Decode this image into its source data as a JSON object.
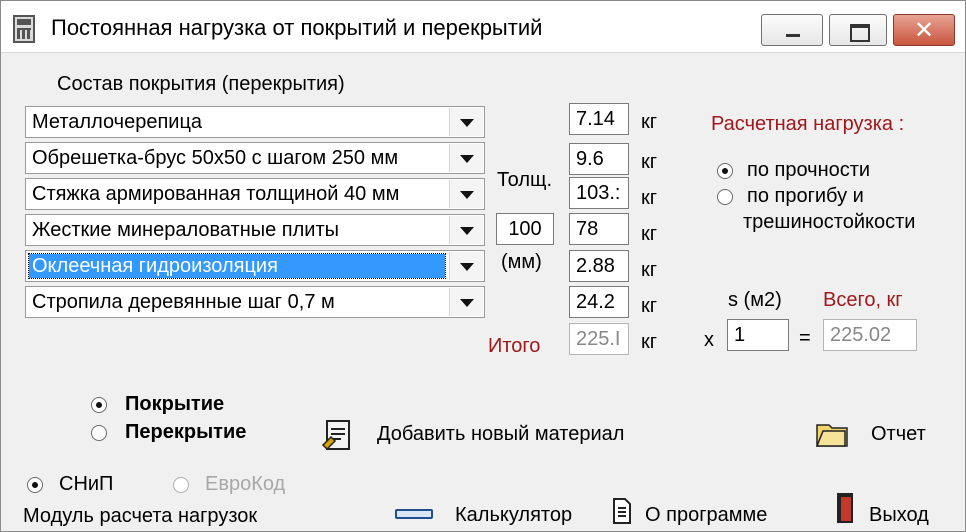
{
  "window": {
    "title": "Постоянная нагрузка от покрытий и перекрытий",
    "icon": "calculator-icon"
  },
  "composition": {
    "label": "Состав покрытия (перекрытия)",
    "layers": [
      {
        "material": "Металлочерепица",
        "weight": "7.14"
      },
      {
        "material": "Обрешетка-брус 50х50 с шагом 250 мм",
        "weight": "9.6"
      },
      {
        "material": "Стяжка армированная толщиной 40 мм",
        "weight": "103.:"
      },
      {
        "material": "Жесткие минераловатные плиты",
        "weight": "78"
      },
      {
        "material": "Оклеечная гидроизоляция",
        "weight": "2.88"
      },
      {
        "material": "Стропила деревянные шаг 0,7 м",
        "weight": "24.2"
      }
    ],
    "unit": "кг",
    "thickness_label": "Толщ.",
    "thickness_value": "100",
    "thickness_unit": "(мм)",
    "total_label": "Итого",
    "total_value": "225.I"
  },
  "calc_load": {
    "label": "Расчетная нагрузка :",
    "options": [
      "по прочности",
      "по прогибу и",
      "трешиностойкости"
    ],
    "selected": 0
  },
  "area": {
    "label": "s (м2)",
    "multiply": "x",
    "value": "1",
    "equals": "=",
    "total_label": "Всего, кг",
    "total_value": "225.02"
  },
  "type": {
    "options": [
      "Покрытие",
      "Перекрытие"
    ],
    "selected": 0
  },
  "actions": {
    "add_material": "Добавить новый материал",
    "report": "Отчет",
    "calculator": "Калькулятор",
    "about": "О программе",
    "exit": "Выход"
  },
  "norms": {
    "options": [
      "СНиП",
      "ЕвроКод"
    ],
    "selected": 0
  },
  "footer": {
    "module": "Модуль расчета нагрузок"
  },
  "colors": {
    "accent_red": "#a0181c",
    "selection": "#3399ff"
  }
}
